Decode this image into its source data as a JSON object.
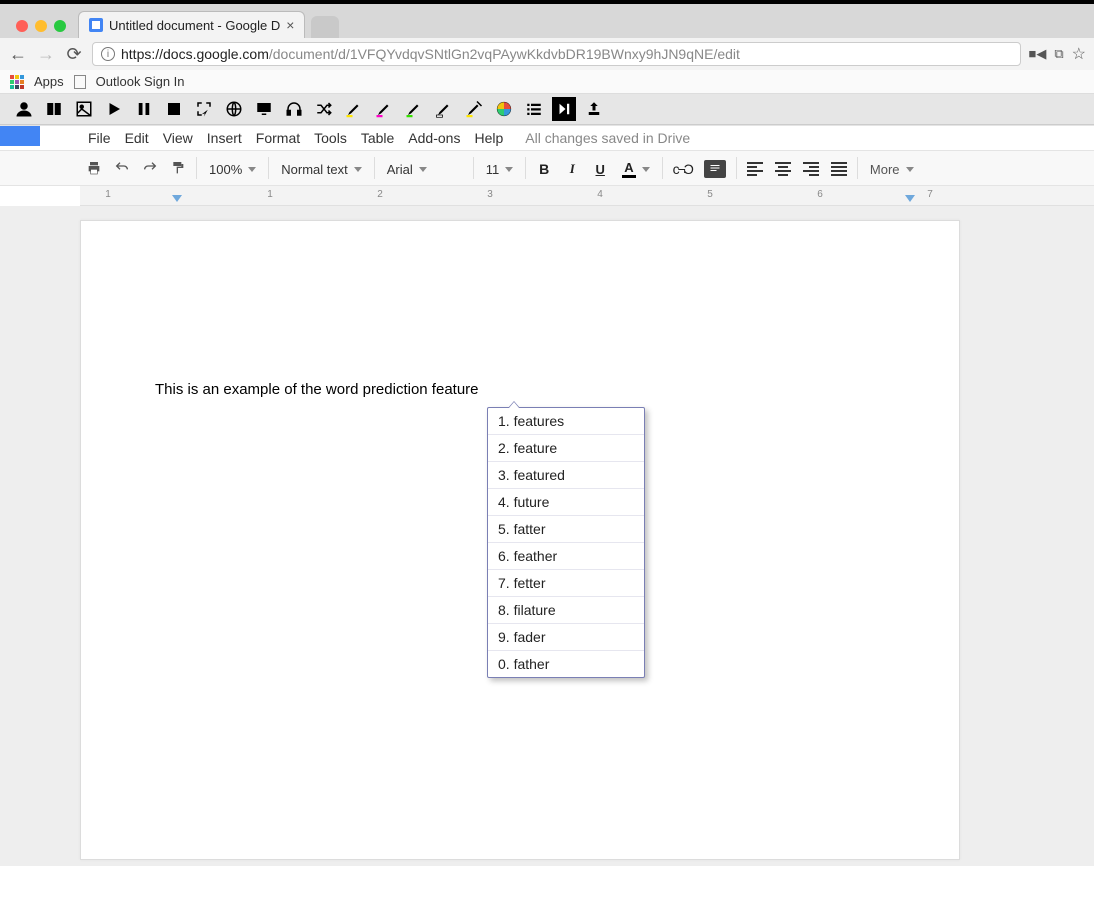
{
  "browser": {
    "tab_title": "Untitled document - Google D",
    "url_display_host": "https://docs.google.com",
    "url_display_path": "/document/d/1VFQYvdqvSNtlGn2vqPAywKkdvbDR19BWnxy9hJN9qNE/edit",
    "bookmarks_apps": "Apps",
    "bookmarks_item": "Outlook Sign In"
  },
  "menus": {
    "file": "File",
    "edit": "Edit",
    "view": "View",
    "insert": "Insert",
    "format": "Format",
    "tools": "Tools",
    "table": "Table",
    "addons": "Add-ons",
    "help": "Help",
    "save_status": "All changes saved in Drive"
  },
  "toolbar": {
    "zoom": "100%",
    "style": "Normal text",
    "font": "Arial",
    "size": "11",
    "bold": "B",
    "italic": "I",
    "underline": "U",
    "text_color": "A",
    "link": "⊂⊃",
    "more": "More"
  },
  "ruler": {
    "marks": [
      "1",
      "1",
      "2",
      "3",
      "4",
      "5",
      "6",
      "7"
    ]
  },
  "document": {
    "text": "This is an example of the word prediction feature"
  },
  "predictions": [
    {
      "n": "1",
      "w": "features"
    },
    {
      "n": "2",
      "w": "feature"
    },
    {
      "n": "3",
      "w": "featured"
    },
    {
      "n": "4",
      "w": "future"
    },
    {
      "n": "5",
      "w": "fatter"
    },
    {
      "n": "6",
      "w": "feather"
    },
    {
      "n": "7",
      "w": "fetter"
    },
    {
      "n": "8",
      "w": "filature"
    },
    {
      "n": "9",
      "w": "fader"
    },
    {
      "n": "0",
      "w": "father"
    }
  ]
}
